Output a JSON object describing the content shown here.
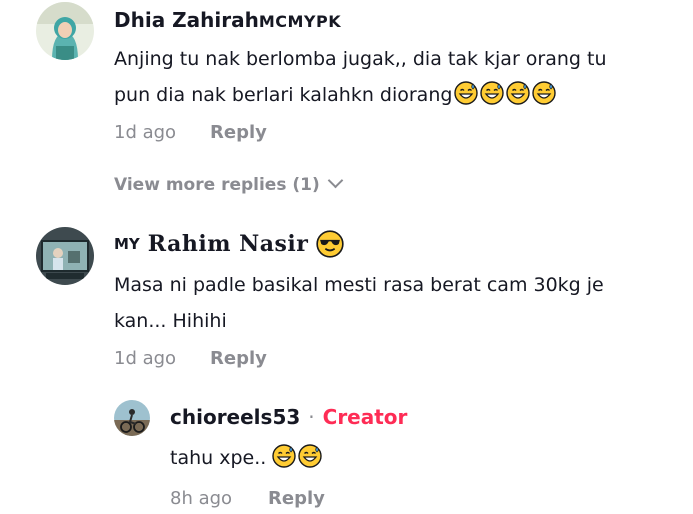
{
  "comments": [
    {
      "username": "Dhia Zahirah",
      "username_suffix": "MCMYPK",
      "text_line1": "Anjing tu nak berlomba jugak,, dia tak kjar orang tu",
      "text_line2": "pun dia nak berlari kalahkn diorang",
      "emoji": [
        "sweat-smile-emoji",
        "sweat-smile-emoji",
        "sweat-smile-emoji",
        "sweat-smile-emoji"
      ],
      "time": "1d ago",
      "reply_label": "Reply"
    },
    {
      "username_prefix": "MY",
      "username": "Rahim Nasir",
      "username_emoji": "sunglasses-emoji",
      "text_line1": "Masa ni padle basikal mesti rasa berat cam 30kg je",
      "text_line2": "kan... Hihihi",
      "time": "1d ago",
      "reply_label": "Reply"
    }
  ],
  "view_more": "View more replies (1)",
  "reply": {
    "username": "chioreels53",
    "separator": "·",
    "badge": "Creator",
    "text": "tahu xpe..",
    "emoji": [
      "sweat-smile-emoji",
      "sweat-smile-emoji"
    ],
    "time": "8h ago",
    "reply_label": "Reply"
  },
  "colors": {
    "text": "#161823",
    "muted": "#8a8b91",
    "creator_badge": "#fe2c55"
  }
}
